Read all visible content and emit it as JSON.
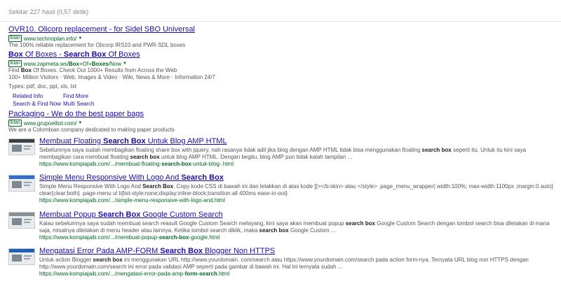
{
  "stats": "Sekitar 227 hasil (0,57 detik)",
  "ads": [
    {
      "title": "OVR10. Olicorp replacement - for Sidel SBO Universal",
      "badge": "Iklan",
      "url": "www.technoplan.info/",
      "desc": [
        "The 100% reliable replacement for Olicorp IRS10 and PWR-SDL boxes"
      ]
    },
    {
      "title_parts": [
        "Box",
        " Of Boxes - ",
        "Search Box",
        " Of Boxes"
      ],
      "badge": "Iklan",
      "url_parts": [
        "www.zapmeta.ws/",
        "Box",
        "+Of+",
        "Boxes",
        "/Now"
      ],
      "desc_parts": [
        "Find ",
        "Box",
        " Of Boxes. Check Out 1000+ Results from Across the Web"
      ],
      "desc2": "100+ Million Visitors · Web, Images & Video · Wiki, News & More · Information 24/7",
      "types": "Types: pdf, doc, ppt, xls, txt",
      "sitelinks": [
        "Related Info",
        "Find More",
        "Search & Find Now",
        "Multi Search"
      ]
    },
    {
      "title": "Packaging - We do the best paper bags",
      "badge": "Iklan",
      "url": "www.grupoelliot.com/",
      "desc": [
        "We are a Colombian company dedicated to making paper products"
      ]
    }
  ],
  "results": [
    {
      "title_parts": [
        "Membuat Floating ",
        "Search Box",
        " Untuk Blog AMP HTML"
      ],
      "desc_parts": [
        "Sebelumnya saya sudah membagikan floating share box with jquery, nah rasanya tidak adil jika blog dengan AMP HTML tidak bisa menggunakan floating ",
        "search box",
        " seperti itu. Untuk itu kini saya membagikan cara membuat floating ",
        "search box",
        " untuk blog AMP HTML. Dengan begitu, blog AMP pun tidak kalah tampilan ..."
      ],
      "url_parts": [
        "https://www.kompiajaib.com/.../membuat-floating-",
        "search-box",
        "-untuk-blog-.html"
      ],
      "thumb_color": "#3a3f45"
    },
    {
      "title_parts": [
        "Simple Menu Responsive With Logo And ",
        "Search Box"
      ],
      "desc_parts": [
        "Simple Menu Responsive With Logo And ",
        "Search Box",
        ". Copy kode CSS di bawah ini dan letakkan di atas kode ]]></b:skin> atau </style> .page_menu_wrapper{ width:100%; max-width:1100px ;margin:0 auto} clear{clear:both} .page-menu ul li{list-style:none;display:inline-block;transition:all 400ms ease-in-out}"
      ],
      "url_parts": [
        "https://www.kompiajaib.com/.../simple-menu-responsive-with-logo-and.html"
      ],
      "thumb_color": "#2e6fc9"
    },
    {
      "title_parts": [
        "Membuat Popup ",
        "Search Box",
        " Google Custom Search"
      ],
      "desc_parts": [
        "Kalau sebelumnya saya sudah membuat search reasult Google Custom Search melayang, kini saya akan membuat popup ",
        "search box",
        " Google Custom Search dengan tombol search bisa diletakan di mana saja, misalnya diletakan di menu header atau lainnya. Ketika tombol search diklik, maka ",
        "search box",
        " Google Custom ..."
      ],
      "url_parts": [
        "https://www.kompiajaib.com/.../membuat-popup-",
        "search-box",
        "-google.html"
      ],
      "thumb_color": "#8a8f96"
    },
    {
      "title_parts": [
        "Mengatasi Error Pada AMP-FORM ",
        "Search Box",
        " Blogger Non HTTPS"
      ],
      "desc_parts": [
        "Untuk action Blogger ",
        "search box",
        " ini menggunakan URL http://www.yourdomain. com/search atau https://www.yourdomain.com/search pada action form-nya. Ternyata URL blog non HTTPS dengan http://www.yourdomain.com/search ini error pada validasi AMP seperti pada gambar di bawah ini. Hal ini ternyata sudah ..."
      ],
      "url_parts": [
        "https://www.kompiajaib.com/.../mengatasi-error-pada-amp-",
        "form-search",
        ".html"
      ],
      "thumb_color": "#1f5fb8"
    }
  ]
}
